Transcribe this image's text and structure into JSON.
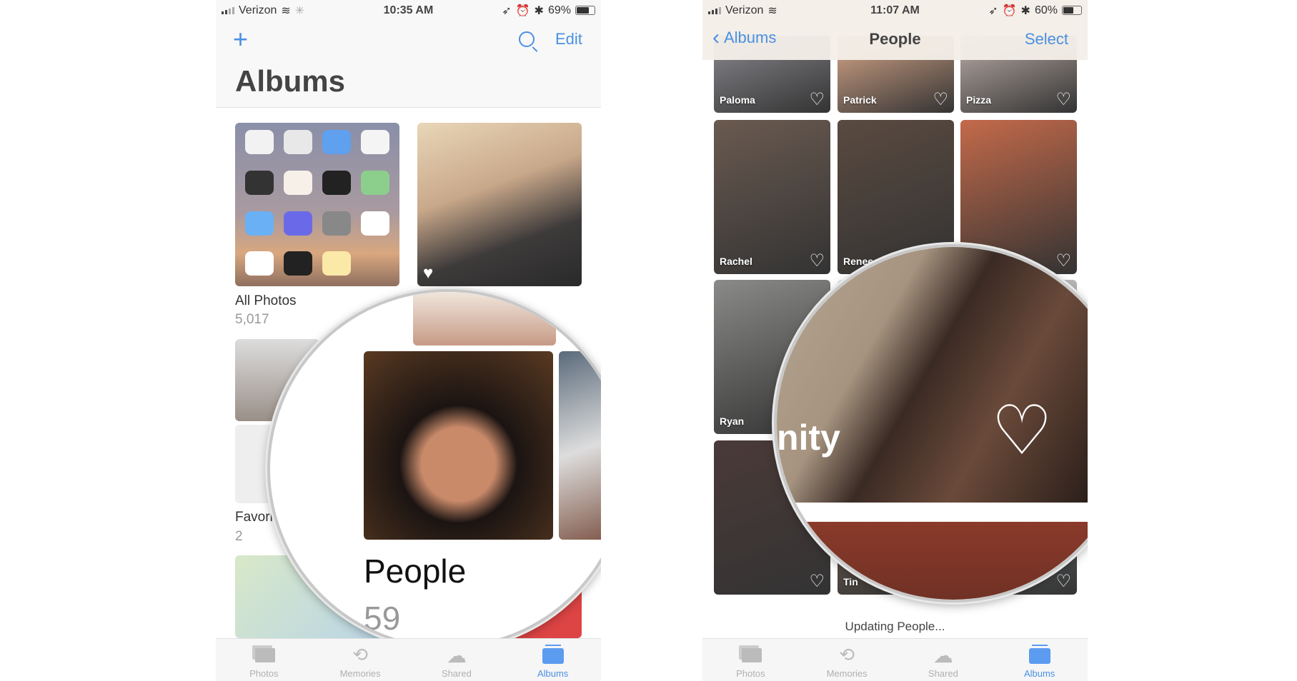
{
  "left": {
    "status": {
      "carrier": "Verizon",
      "time": "10:35 AM",
      "battery": "69%",
      "battery_level": 0.69
    },
    "nav": {
      "add_icon": "+",
      "search_icon": "search-icon",
      "edit_label": "Edit"
    },
    "title": "Albums",
    "albums": [
      {
        "name": "All Photos",
        "count": "5,017"
      },
      {
        "name": "Favori",
        "count": "2"
      }
    ],
    "magnifier": {
      "album_name": "People",
      "count": "59"
    },
    "tabs": [
      {
        "label": "Photos",
        "icon": "photos-icon"
      },
      {
        "label": "Memories",
        "icon": "memories-icon"
      },
      {
        "label": "Shared",
        "icon": "cloud-icon"
      },
      {
        "label": "Albums",
        "icon": "albums-icon",
        "active": true
      }
    ]
  },
  "right": {
    "status": {
      "carrier": "Verizon",
      "time": "11:07 AM",
      "battery": "60%",
      "battery_level": 0.6
    },
    "nav": {
      "back_label": "Albums",
      "title": "People",
      "select_label": "Select"
    },
    "people": [
      "Paloma",
      "Patrick",
      "Pizza",
      "Rachel",
      "Renee",
      "",
      "Ryan",
      "",
      "",
      "",
      "Tin",
      ""
    ],
    "magnifier": {
      "text": "nity"
    },
    "footer": "Updating People...",
    "tabs": [
      {
        "label": "Photos",
        "icon": "photos-icon"
      },
      {
        "label": "Memories",
        "icon": "memories-icon"
      },
      {
        "label": "Shared",
        "icon": "cloud-icon"
      },
      {
        "label": "Albums",
        "icon": "albums-icon",
        "active": true
      }
    ]
  },
  "colors": {
    "accent": "#4a90e2",
    "tab_inactive": "#b0b0b0"
  }
}
